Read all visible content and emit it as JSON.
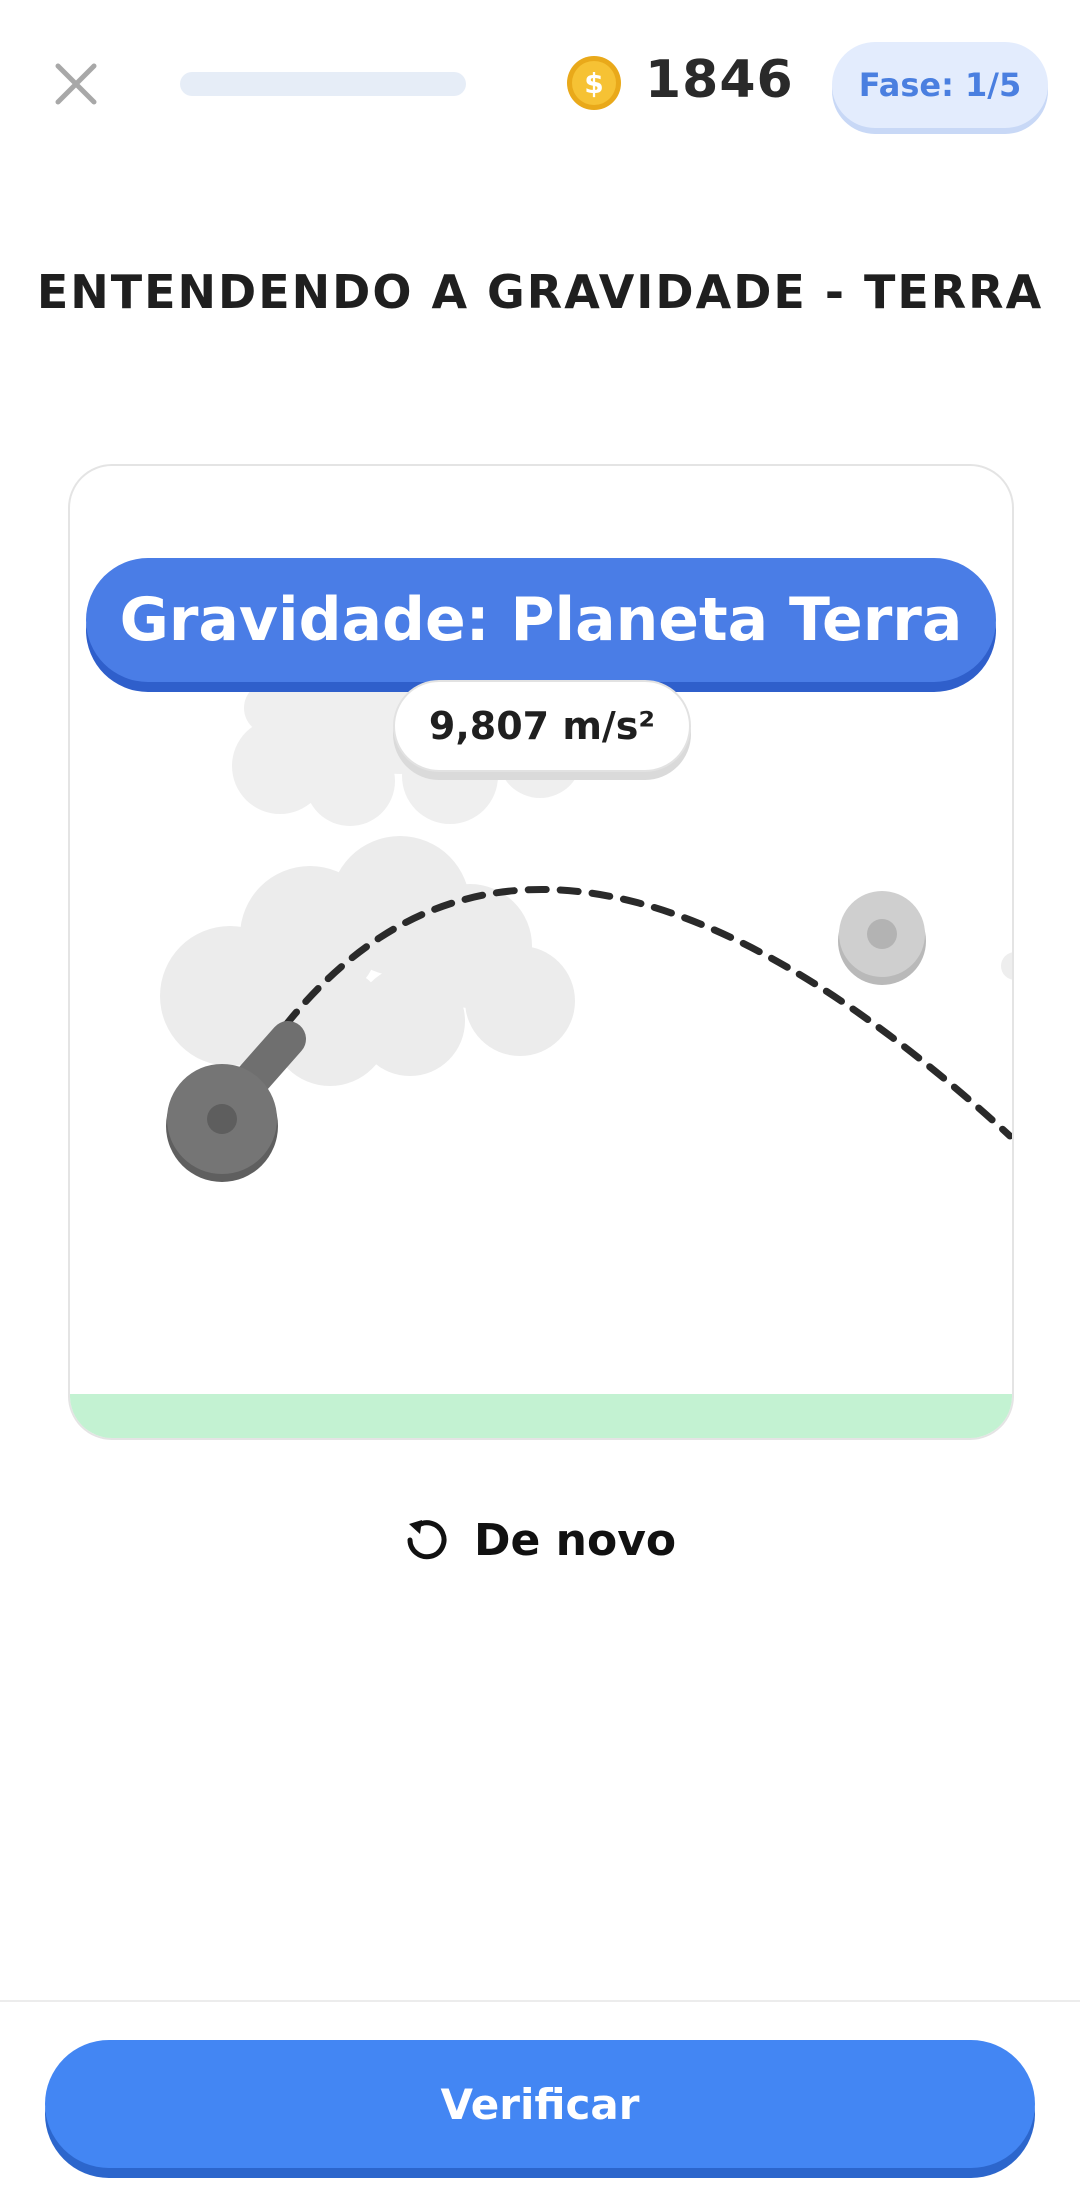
{
  "header": {
    "close_icon": "close-icon",
    "progress_fraction": 0.0,
    "coin_icon": "coin-icon",
    "coins": "1846",
    "phase_label": "Fase: 1/5"
  },
  "title": "ENTENDENDO A GRAVIDADE - TERRA",
  "simulation": {
    "banner": "Gravidade: Planeta Terra",
    "gravity_value": "9,807 m/s²",
    "ground_color": "#c3f2d2"
  },
  "actions": {
    "retry_icon": "retry-icon",
    "retry_label": "De novo",
    "verify_label": "Verificar"
  },
  "colors": {
    "accent": "#4386f3",
    "banner": "#4a7de6",
    "phase_badge_bg": "#e3ecfd"
  }
}
